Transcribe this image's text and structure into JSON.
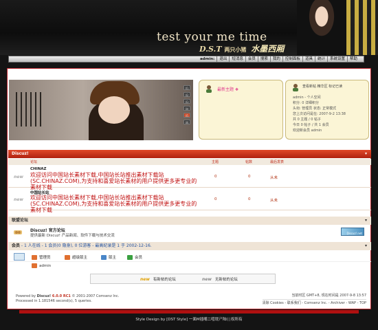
{
  "header": {
    "brand_line1": "test your me time",
    "brand_line2": "D.S.T",
    "brand_sub": "两只小猪",
    "brand_flourish": "水墨西厢"
  },
  "nav": {
    "user": "admin:",
    "items": [
      "退出",
      "短消息",
      "会员",
      "搜索",
      "我的",
      "控制面板",
      "道具",
      "统计",
      "系统设置",
      "帮助"
    ]
  },
  "slideshow": {
    "numbers": [
      "01",
      "02",
      "03",
      "04",
      "05",
      "06"
    ],
    "active_index": 5
  },
  "notice": {
    "title": "最新主题 ❖"
  },
  "userbox": {
    "links": "查看新帖  精华区  标记已读",
    "lines": [
      "admin - 个人空间",
      "积分: 0 详细积分",
      "头衔: 管理员  状态: 正常模式",
      "您上次访问是在: 2007-9-2 13:38",
      "共 0 主题 / 0 帖子",
      "今日 0 帖子 / 共 1 会员",
      "欢迎新会员 admin"
    ]
  },
  "forum": {
    "bar_title": "Discuz!",
    "columns": [
      "论坛",
      "主题",
      "帖数",
      "最后发表"
    ],
    "rows": [
      {
        "name": "CHINAZ",
        "desc": "欢迎访问中国站长素材下载,中国站长站推出素材下载站(SC.CHINAZ.COM),为支持和喜爱站长素材的用户提供更多更专业的素材下载",
        "topics": "0",
        "posts": "0",
        "last": "从未"
      },
      {
        "name": "中国站长站",
        "desc": "欢迎访问中国站长素材下载,中国站长站推出素材下载站(SC.CHINAZ.COM),为支持和喜爱站长素材的用户提供更多更专业的素材下载",
        "topics": "0",
        "posts": "0",
        "last": "从未"
      }
    ],
    "new_tag": "new"
  },
  "league": {
    "bar_title": "联盟论坛",
    "name": "Discuz! 官方论坛",
    "desc": "提供最新 Discuz! 产品新闻、软件下载与技术交流",
    "logo_text": "Discuz!.net"
  },
  "online": {
    "label": "会员",
    "stat": " - 1 人在线 - 1 会员(0 隐身), 0 位游客 - 最高纪录是 1 于 2002-12-16.",
    "legend": [
      {
        "label": "管理员",
        "color": "#e07030"
      },
      {
        "label": "超级版主",
        "color": "#e07030"
      },
      {
        "label": "版主",
        "color": "#4a86c8"
      },
      {
        "label": "会员",
        "color": "#3aa040"
      }
    ],
    "users": [
      "admin"
    ]
  },
  "newbox": {
    "has_new": "有新帖的论坛",
    "no_new": "无新帖的论坛",
    "tag": "new"
  },
  "footer": {
    "powered_prefix": "Powered by ",
    "powered_name": "Discuz!",
    "version": " 6.0.0 RC1",
    "copyright": " © 2001-2007 Comsenz Inc.",
    "processed": "Processed in 1.181546 second(s), 5 queries.",
    "time": "当前时区 GMT+8, 现在时间是 2007-9-8 13:57",
    "links": "清除 Cookies - 联系我们 - Comsenz Inc. - Archiver - WAP - TOP"
  },
  "bottom_line": "Style Design by [DST Style] 一面M插嘴二喧堤ㄕ陆l∣∣权所有"
}
